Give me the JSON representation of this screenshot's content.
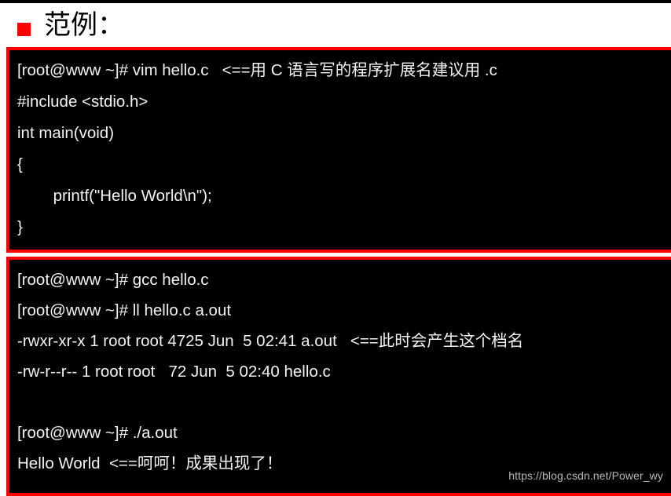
{
  "slide": {
    "heading": "范例：",
    "bullet_icon": "red-square-bullet",
    "accent_color": "#ff0000",
    "terminal_background": "#000000",
    "terminal_text_color": "#f2f2f2"
  },
  "terminal_blocks": [
    {
      "id": "vim-hello-c",
      "lines": [
        "[root@www ~]# vim hello.c   <==用 C 语言写的程序扩展名建议用 .c",
        "#include <stdio.h>",
        "int main(void)",
        "{",
        "        printf(\"Hello World\\n\");",
        "}"
      ]
    },
    {
      "id": "gcc-compile-run",
      "lines": [
        "[root@www ~]# gcc hello.c",
        "[root@www ~]# ll hello.c a.out",
        "-rwxr-xr-x 1 root root 4725 Jun  5 02:41 a.out   <==此时会产生这个档名",
        "-rw-r--r-- 1 root root   72 Jun  5 02:40 hello.c",
        "",
        "[root@www ~]# ./a.out",
        "Hello World  <==呵呵！成果出现了！"
      ]
    }
  ],
  "watermark": {
    "text": "https://blog.csdn.net/Power_wy"
  }
}
